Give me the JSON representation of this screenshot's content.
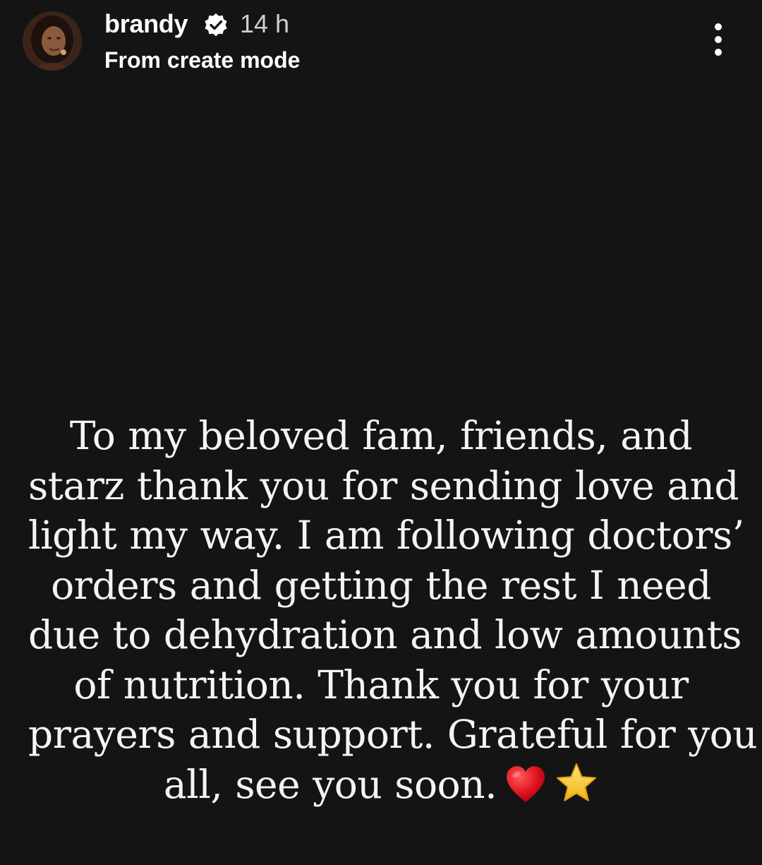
{
  "story": {
    "author": {
      "username": "brandy",
      "verified": true,
      "verified_icon": "verified-badge-icon",
      "time_ago": "14 h",
      "source_label": "From create mode"
    },
    "menu_icon": "more-vertical-icon",
    "message_lines": [
      "To my beloved fam, friends, and",
      "starz thank you for sending love and",
      "light my way. I am following doctors’",
      "orders and getting the rest I need",
      "due to dehydration and low amounts",
      "of nutrition. Thank you for your",
      "prayers and support. Grateful for you",
      "all, see you soon."
    ],
    "emojis": [
      "red-heart-icon",
      "star-icon"
    ],
    "colors": {
      "background": "#141414",
      "text": "#f4f4f4",
      "heart": "#e0121f",
      "star": "#f7c531"
    }
  }
}
